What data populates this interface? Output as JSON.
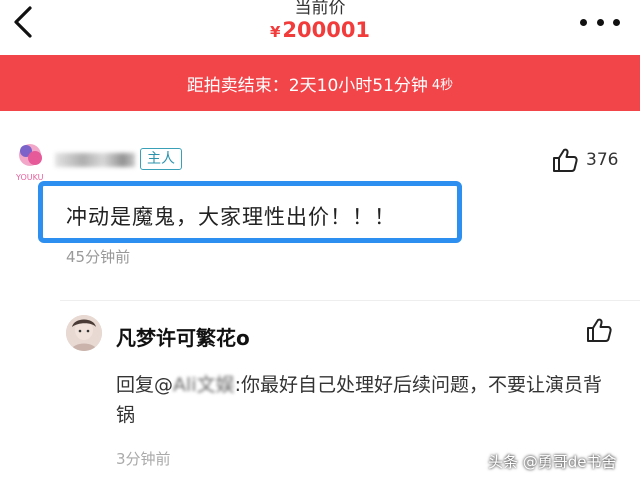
{
  "header": {
    "price_label": "当前价",
    "currency": "¥",
    "price": "200001"
  },
  "countdown": {
    "text": "距拍卖结束：2天10小时51分钟",
    "seconds": "4秒"
  },
  "main_comment": {
    "badge": "主人",
    "like_count": "376",
    "text": "冲动是魔鬼，大家理性出价！！！",
    "time": "45分钟前"
  },
  "reply": {
    "username": "凡梦许可繁花o",
    "text_prefix": "回复@",
    "text_blurred": "Ali文娱",
    "text_body": ":你最好自己处理好后续问题，不要让演员背锅",
    "time": "3分钟前"
  },
  "watermark": "头条 @勇哥de书舍",
  "colors": {
    "accent_red": "#f2454a",
    "price_red": "#f23b3b",
    "highlight_blue": "#2d8ff0",
    "badge_teal": "#39a0b8"
  },
  "icons": {
    "back": "chevron-left-icon",
    "more": "more-dots-icon",
    "like": "thumbs-up-icon"
  }
}
